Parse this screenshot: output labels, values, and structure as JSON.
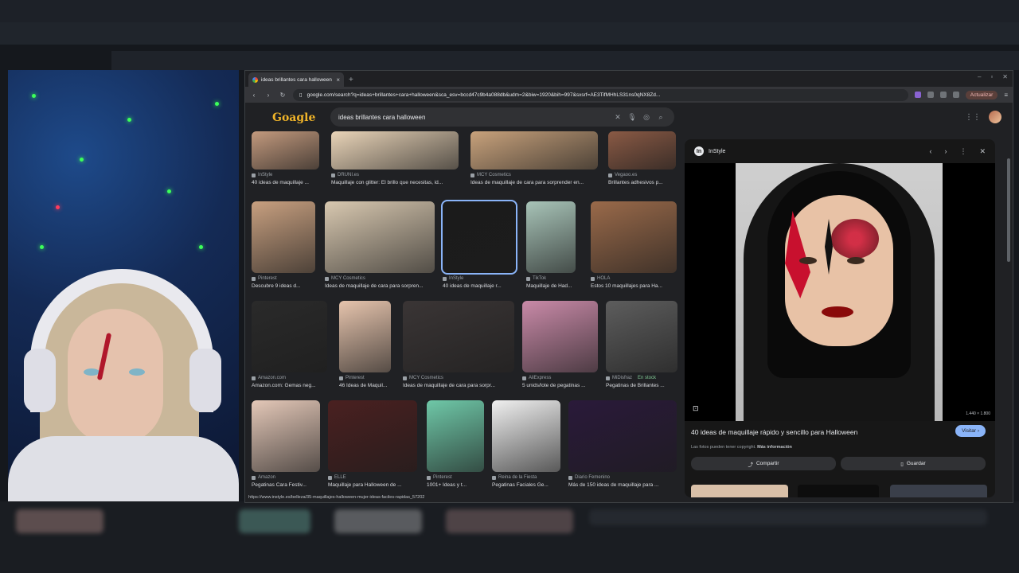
{
  "browser": {
    "tab_title": "ideas brillantes cara halloween",
    "url": "google.com/search?q=ideas+brillantes+cara+halloween&sca_esv=bccd47c9b4a088db&udm=2&biw=1920&bih=997&sxsrf=AE3TifMHhLS31ns0qNX8Zd...",
    "update_label": "Actualizar"
  },
  "search": {
    "query": "ideas brillantes cara halloween",
    "doodle_text": "Goagle"
  },
  "results": {
    "rows": [
      {
        "items": [
          {
            "source": "InStyle",
            "caption": "40 ideas de maquillaje ...",
            "selected": false,
            "stock": ""
          },
          {
            "source": "DRUNI.es",
            "caption": "Maquillaje con glitter: El brillo que necesitas, id...",
            "selected": false,
            "stock": ""
          },
          {
            "source": "MCY Cosmetics",
            "caption": "Ideas de maquillaje de cara para sorprender en...",
            "selected": false,
            "stock": ""
          },
          {
            "source": "Vegaoo.es",
            "caption": "Brillantes adhesivos p...",
            "selected": false,
            "stock": ""
          }
        ]
      },
      {
        "items": [
          {
            "source": "Pinterest",
            "caption": "Descubre 9 ideas d...",
            "selected": false,
            "stock": ""
          },
          {
            "source": "MCY Cosmetics",
            "caption": "Ideas de maquillaje de cara para sorpren...",
            "selected": false,
            "stock": ""
          },
          {
            "source": "InStyle",
            "caption": "40 ideas de maquillaje r...",
            "selected": true,
            "stock": ""
          },
          {
            "source": "TikTok",
            "caption": "Maquillaje de Had...",
            "selected": false,
            "stock": ""
          },
          {
            "source": "HOLA",
            "caption": "Estos 10 maquillajes para Ha...",
            "selected": false,
            "stock": ""
          }
        ]
      },
      {
        "items": [
          {
            "source": "Amazon.com",
            "caption": "Amazon.com: Gemas neg...",
            "selected": false,
            "stock": ""
          },
          {
            "source": "Pinterest",
            "caption": "46 Ideas de Maquil...",
            "selected": false,
            "stock": ""
          },
          {
            "source": "MCY Cosmetics",
            "caption": "Ideas de maquillaje de cara para sorpr...",
            "selected": false,
            "stock": ""
          },
          {
            "source": "AliExpress",
            "caption": "5 unids/lote de pegatinas ...",
            "selected": false,
            "stock": ""
          },
          {
            "source": "MiDisfraz",
            "caption": "Pegatinas de Brillantes ...",
            "selected": false,
            "stock": "En stock"
          }
        ]
      },
      {
        "items": [
          {
            "source": "Amazon",
            "caption": "Pegatinas Cara Festiv...",
            "selected": false,
            "stock": ""
          },
          {
            "source": "ELLE",
            "caption": "Maquillaje para Halloween de ...",
            "selected": false,
            "stock": ""
          },
          {
            "source": "Pinterest",
            "caption": "1001+ Ideas y t...",
            "selected": false,
            "stock": ""
          },
          {
            "source": "Reina de la Fiesta",
            "caption": "Pegatinas Faciales Ge...",
            "selected": false,
            "stock": ""
          },
          {
            "source": "Diario Femenino",
            "caption": "Más de 150 ideas de maquillaje para ...",
            "selected": false,
            "stock": ""
          }
        ]
      }
    ]
  },
  "preview": {
    "source": "InStyle",
    "title": "40 ideas de maquillaje rápido y sencillo para Halloween",
    "visit_label": "Visitar",
    "copyright": "Las fotos pueden tener copyright.",
    "more_info": "Más información",
    "share_label": "Compartir",
    "save_label": "Guardar",
    "dimensions": "1.440 × 1.800"
  },
  "status_url": "https://www.instyle.es/belleza/35-maquillajes-halloween-mujer-ideas-faciles-rapidas_57202",
  "colors": {
    "accent": "#8ab4f8",
    "background": "#202124",
    "panel": "#171717"
  }
}
